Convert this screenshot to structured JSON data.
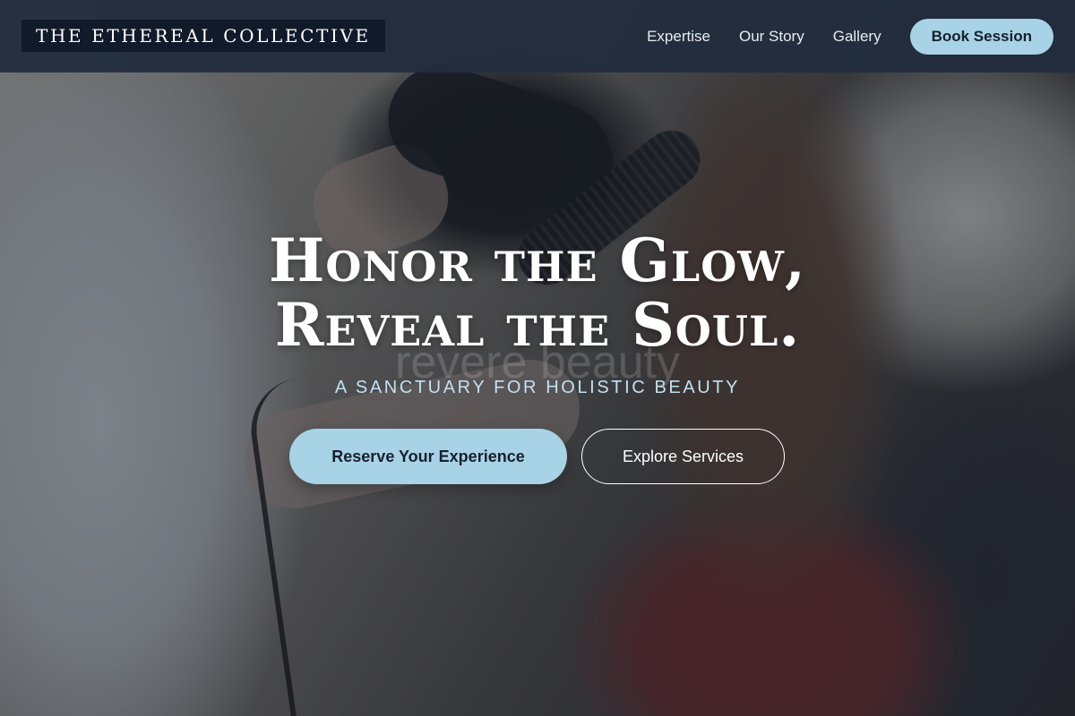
{
  "header": {
    "brand": "THE ETHEREAL COLLECTIVE",
    "nav": [
      {
        "label": "Expertise"
      },
      {
        "label": "Our Story"
      },
      {
        "label": "Gallery"
      }
    ],
    "book_label": "Book Session"
  },
  "hero": {
    "headline_line1": "Honor the Glow,",
    "headline_line2": "Reveal the Soul.",
    "watermark": "revere beauty",
    "tagline": "A SANCTUARY FOR HOLISTIC BEAUTY",
    "primary_cta": "Reserve Your Experience",
    "secondary_cta": "Explore Services"
  },
  "colors": {
    "header_bg": "#222c3d",
    "brand_bg": "#111a2b",
    "accent": "#a8d3e6",
    "tagline": "#bfe2f0"
  }
}
